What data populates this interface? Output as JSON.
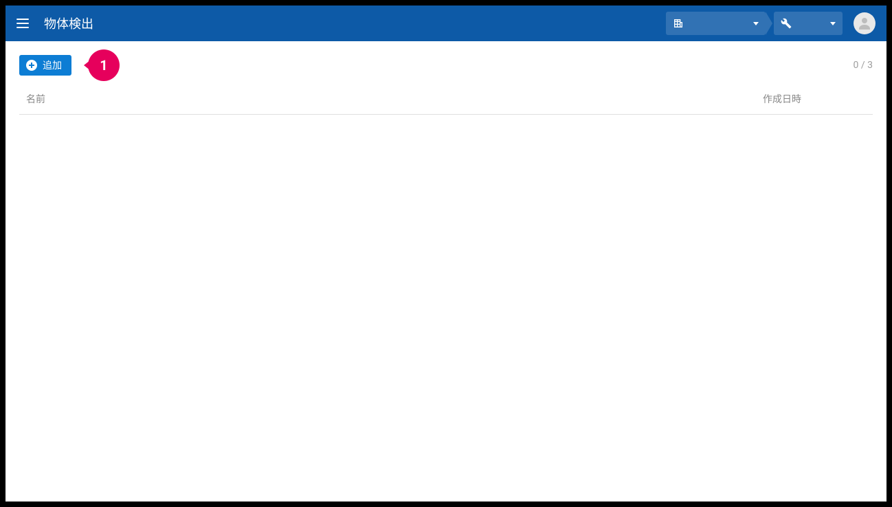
{
  "header": {
    "title": "物体検出",
    "org_dropdown_text": "",
    "tool_dropdown_text": ""
  },
  "actions": {
    "add_label": "追加"
  },
  "callout": {
    "number": "1"
  },
  "count": {
    "text": "0 / 3"
  },
  "table": {
    "col_name": "名前",
    "col_date": "作成日時",
    "rows": []
  }
}
